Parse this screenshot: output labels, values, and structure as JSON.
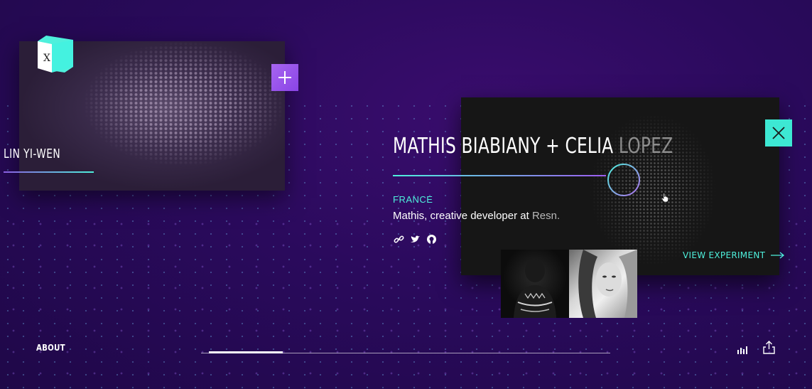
{
  "logo": {
    "letter": "X"
  },
  "left_project": {
    "name": "LIN YI-WEN",
    "open_icon": "plus-icon"
  },
  "featured": {
    "title_primary": "MATHIS BIABIANY + CELIA ",
    "title_muted": "LOPEZ",
    "country": "FRANCE",
    "description_name": "Mathis, creative developer",
    "description_at": "at",
    "description_org": "Resn.",
    "social_icons": [
      "link-icon",
      "twitter-icon",
      "github-icon"
    ],
    "view_label": "VIEW EXPERIMENT",
    "close_icon": "close-icon"
  },
  "footer": {
    "about_label": "ABOUT",
    "icons": [
      "stats-icon",
      "share-icon"
    ]
  },
  "colors": {
    "accent": "#4ef0dc",
    "purple": "#9c5cf0",
    "background": "#2a0a5c"
  }
}
